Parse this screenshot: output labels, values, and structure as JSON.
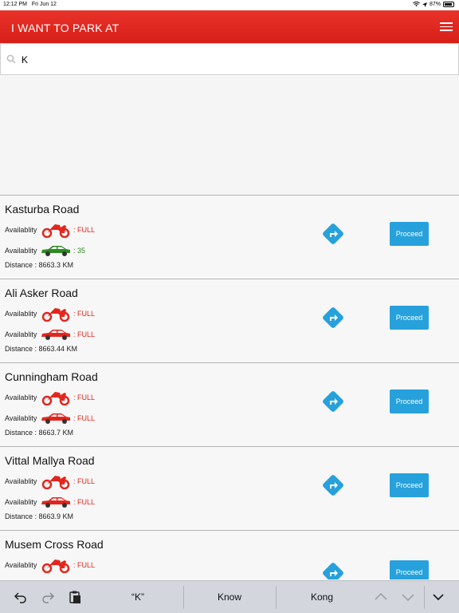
{
  "status_bar": {
    "time": "12:12 PM",
    "date": "Fri Jun 12",
    "battery": "87%"
  },
  "header": {
    "title": "I WANT TO PARK AT",
    "menu_icon": "hamburger-menu-icon"
  },
  "search": {
    "value": "K",
    "placeholder": ""
  },
  "colors": {
    "header_red": "#e3261d",
    "full_red": "#e3261d",
    "available_green": "#2e8b22",
    "proceed_blue": "#27a1dc"
  },
  "results": [
    {
      "name": "Kasturba Road",
      "bike_label": "Availablity",
      "bike_status": ": FULL",
      "bike_full": true,
      "car_label": "Availablity",
      "car_status": ": 35",
      "car_full": false,
      "distance": "Distance : 8663.3 KM",
      "proceed": "Proceed"
    },
    {
      "name": "Ali Asker Road",
      "bike_label": "Availablity",
      "bike_status": ": FULL",
      "bike_full": true,
      "car_label": "Availablity",
      "car_status": ": FULL",
      "car_full": true,
      "distance": "Distance : 8663.44 KM",
      "proceed": "Proceed"
    },
    {
      "name": "Cunningham Road",
      "bike_label": "Availablity",
      "bike_status": ": FULL",
      "bike_full": true,
      "car_label": "Availablity",
      "car_status": ": FULL",
      "car_full": true,
      "distance": "Distance : 8663.7 KM",
      "proceed": "Proceed"
    },
    {
      "name": "Vittal Mallya Road",
      "bike_label": "Availablity",
      "bike_status": ": FULL",
      "bike_full": true,
      "car_label": "Availablity",
      "car_status": ": FULL",
      "car_full": true,
      "distance": "Distance : 8663.9 KM",
      "proceed": "Proceed"
    },
    {
      "name": "Musem Cross Road",
      "bike_label": "Availablity",
      "bike_status": ": FULL",
      "bike_full": true,
      "car_label": "",
      "car_status": "",
      "car_full": true,
      "distance": "",
      "proceed": "Proceed"
    }
  ],
  "keyboard_bar": {
    "suggestions": [
      "“K”",
      "Know",
      "Kong"
    ]
  }
}
